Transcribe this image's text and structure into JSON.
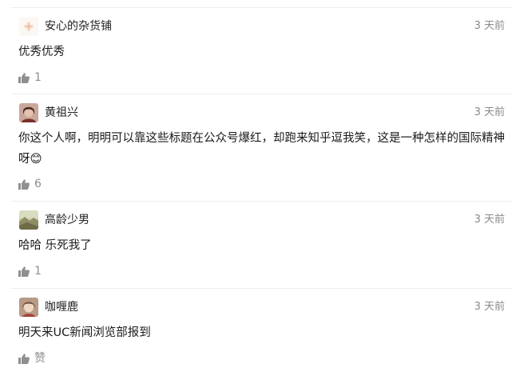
{
  "comments": [
    {
      "username": "安心的杂货铺",
      "time": "3 天前",
      "text": "优秀优秀",
      "likes": "1",
      "avatar_icon": "flower-avatar-icon"
    },
    {
      "username": "黄祖兴",
      "time": "3 天前",
      "text": "你这个人啊，明明可以靠这些标题在公众号爆红，却跑来知乎逗我笑，这是一种怎样的国际精神呀😊",
      "likes": "6",
      "avatar_icon": "portrait-avatar-icon"
    },
    {
      "username": "高龄少男",
      "time": "3 天前",
      "text": "哈哈 乐死我了",
      "likes": "1",
      "avatar_icon": "landscape-avatar-icon"
    },
    {
      "username": "咖喱鹿",
      "time": "3 天前",
      "text": "明天来UC新闻浏览部报到",
      "likes": "赞",
      "avatar_icon": "girl-avatar-icon"
    }
  ],
  "colors": {
    "text": "#1a1a1a",
    "muted": "#8a8a8a",
    "divider": "#ececec"
  }
}
